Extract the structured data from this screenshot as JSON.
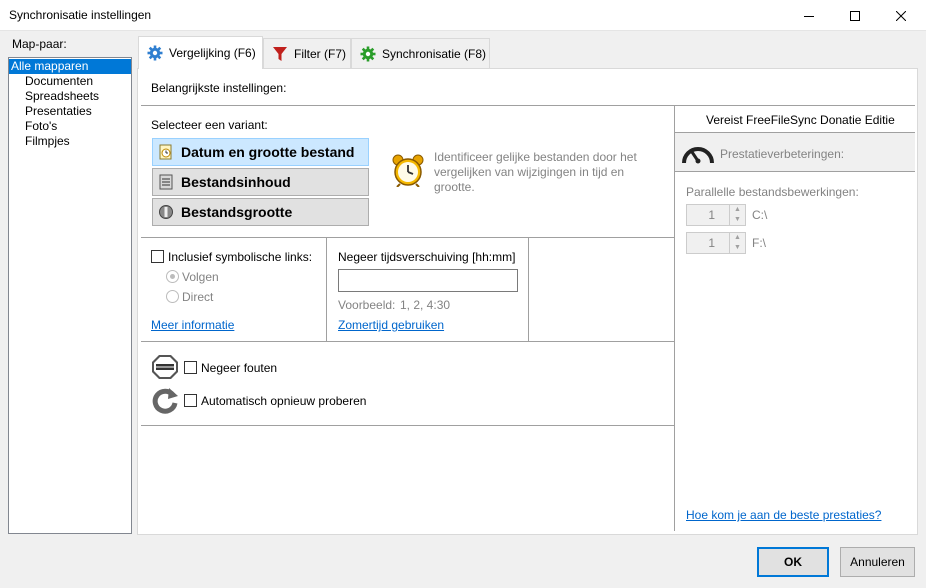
{
  "window": {
    "title": "Synchronisatie instellingen"
  },
  "left": {
    "heading": "Map-paar:",
    "items": [
      {
        "label": "Alle mapparen",
        "selected": true
      },
      {
        "label": "Documenten"
      },
      {
        "label": "Spreadsheets"
      },
      {
        "label": "Presentaties"
      },
      {
        "label": "Foto's"
      },
      {
        "label": "Filmpjes"
      }
    ]
  },
  "tabs": [
    {
      "label": "Vergelijking (F6)",
      "icon": "gear-icon",
      "active": true
    },
    {
      "label": "Filter (F7)",
      "icon": "filter-icon"
    },
    {
      "label": "Synchronisatie (F8)",
      "icon": "sync-gear-icon"
    }
  ],
  "main": {
    "heading": "Belangrijkste instellingen:",
    "variant_label": "Selecteer een variant:",
    "variants": [
      {
        "label": "Datum en grootte bestand",
        "icon": "clock-file-icon",
        "selected": true
      },
      {
        "label": "Bestandsinhoud",
        "icon": "file-content-icon"
      },
      {
        "label": "Bestandsgrootte",
        "icon": "file-size-icon"
      }
    ],
    "description": [
      "Identificeer gelijke bestanden door het",
      "vergelijken van wijzigingen in tijd en",
      "grootte."
    ],
    "symlinks": {
      "label": "Inclusief symbolische links:",
      "option1": "Volgen",
      "option2": "Direct",
      "more_info": "Meer informatie"
    },
    "timeshift": {
      "label": "Negeer tijdsverschuiving [hh:mm]",
      "value": "",
      "example_label": "Voorbeeld:",
      "example_value": "1, 2, 4:30",
      "dst_link": "Zomertijd gebruiken"
    },
    "ignore_errors": "Negeer fouten",
    "auto_retry": "Automatisch opnieuw proberen"
  },
  "right": {
    "header": "Vereist FreeFileSync Donatie Editie",
    "perf_label": "Prestatieverbeteringen:",
    "parallel_label": "Parallelle bestandsbewerkingen:",
    "drives": [
      {
        "count": "1",
        "path": "C:\\"
      },
      {
        "count": "1",
        "path": "F:\\"
      }
    ],
    "link": "Hoe kom je aan de beste prestaties?"
  },
  "buttons": {
    "ok": "OK",
    "cancel": "Annuleren"
  },
  "colors": {
    "selection": "#0078d7",
    "link": "#0066cc",
    "variant_selected_bg": "#cce8ff"
  }
}
